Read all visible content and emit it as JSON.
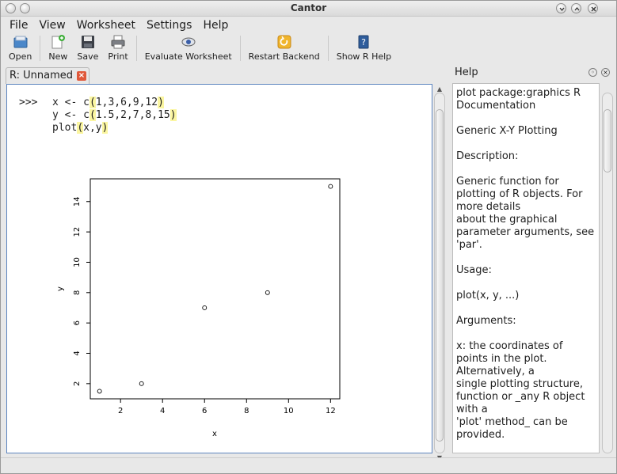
{
  "window": {
    "title": "Cantor"
  },
  "menubar": {
    "items": [
      {
        "label": "File"
      },
      {
        "label": "View"
      },
      {
        "label": "Worksheet"
      },
      {
        "label": "Settings"
      },
      {
        "label": "Help"
      }
    ]
  },
  "toolbar": {
    "buttons": [
      {
        "label": "Open",
        "icon": "open-icon"
      },
      {
        "label": "New",
        "icon": "new-icon"
      },
      {
        "label": "Save",
        "icon": "save-icon"
      },
      {
        "label": "Print",
        "icon": "print-icon"
      },
      {
        "label": "Evaluate Worksheet",
        "icon": "evaluate-icon"
      },
      {
        "label": "Restart Backend",
        "icon": "restart-icon"
      },
      {
        "label": "Show R Help",
        "icon": "help-book-icon"
      }
    ]
  },
  "tab": {
    "label": "R: Unnamed"
  },
  "worksheet": {
    "prompt": ">>>",
    "code_lines": [
      {
        "pre": "x <- c",
        "args": "1,3,6,9,12"
      },
      {
        "pre": "y <- c",
        "args": "1.5,2,7,8,15"
      },
      {
        "pre": "plot",
        "args": "x,y"
      }
    ]
  },
  "chart_data": {
    "type": "scatter",
    "x": [
      1,
      3,
      6,
      9,
      12
    ],
    "y": [
      1.5,
      2,
      7,
      8,
      15
    ],
    "xlabel": "x",
    "ylabel": "y",
    "xlim": [
      0.56,
      12.44
    ],
    "ylim": [
      1.0,
      15.5
    ],
    "xticks": [
      2,
      4,
      6,
      8,
      10,
      12
    ],
    "yticks": [
      2,
      4,
      6,
      8,
      10,
      12,
      14
    ],
    "marker": "open-circle",
    "grid": false
  },
  "help": {
    "title": "Help",
    "lines": [
      "plot package:graphics R",
      "Documentation",
      "",
      "Generic X-Y Plotting",
      "",
      "Description:",
      "",
      "Generic function for",
      "plotting of R objects. For",
      "more details",
      "about the graphical",
      "parameter arguments, see",
      "'par'.",
      "",
      "Usage:",
      "",
      "plot(x, y, ...)",
      "",
      "Arguments:",
      "",
      "x: the coordinates of",
      "points in the plot.",
      "Alternatively, a",
      "single plotting structure,",
      "function or _any R object",
      "with a",
      "'plot' method_ can be",
      "provided."
    ]
  },
  "colors": {
    "accent": "#5d85bf",
    "paren_highlight": "#fbf6a1",
    "close_tab": "#e0583a"
  }
}
